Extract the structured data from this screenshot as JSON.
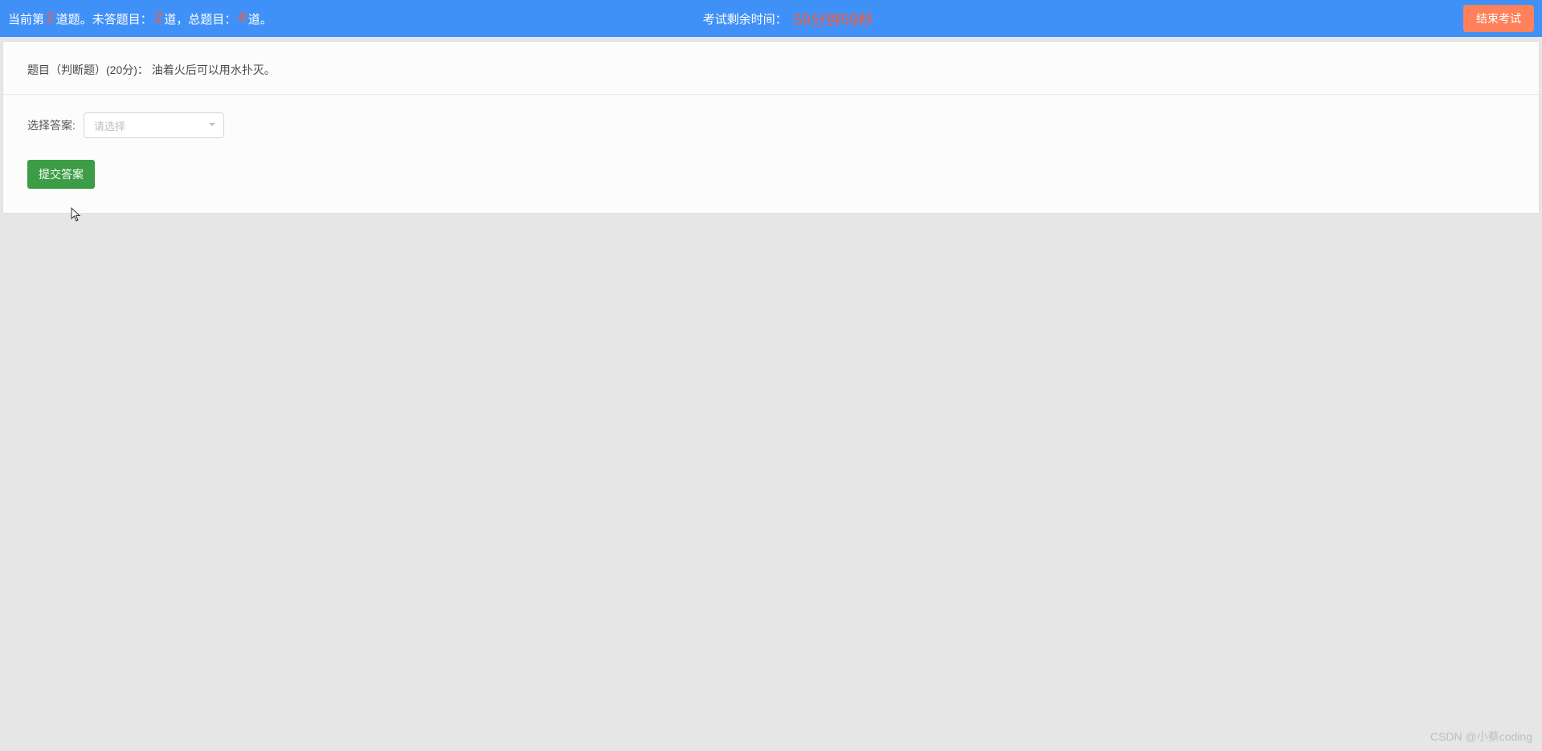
{
  "header": {
    "left": {
      "prefix1": "当前第",
      "current_question": "2",
      "suffix1": "道题。未答题目：",
      "unanswered": "2",
      "suffix2": "道，总题目：",
      "total": "4",
      "suffix3": "道。"
    },
    "center": {
      "timer_label": "考试剩余时间：",
      "timer_value": "59分钟59秒"
    },
    "right": {
      "end_exam_label": "结束考试"
    }
  },
  "question": {
    "text": "题目（判断题）(20分)：  油着火后可以用水扑灭。"
  },
  "answer": {
    "label": "选择答案:",
    "placeholder": "请选择"
  },
  "submit": {
    "label": "提交答案"
  },
  "watermark": "CSDN @小蔡coding"
}
